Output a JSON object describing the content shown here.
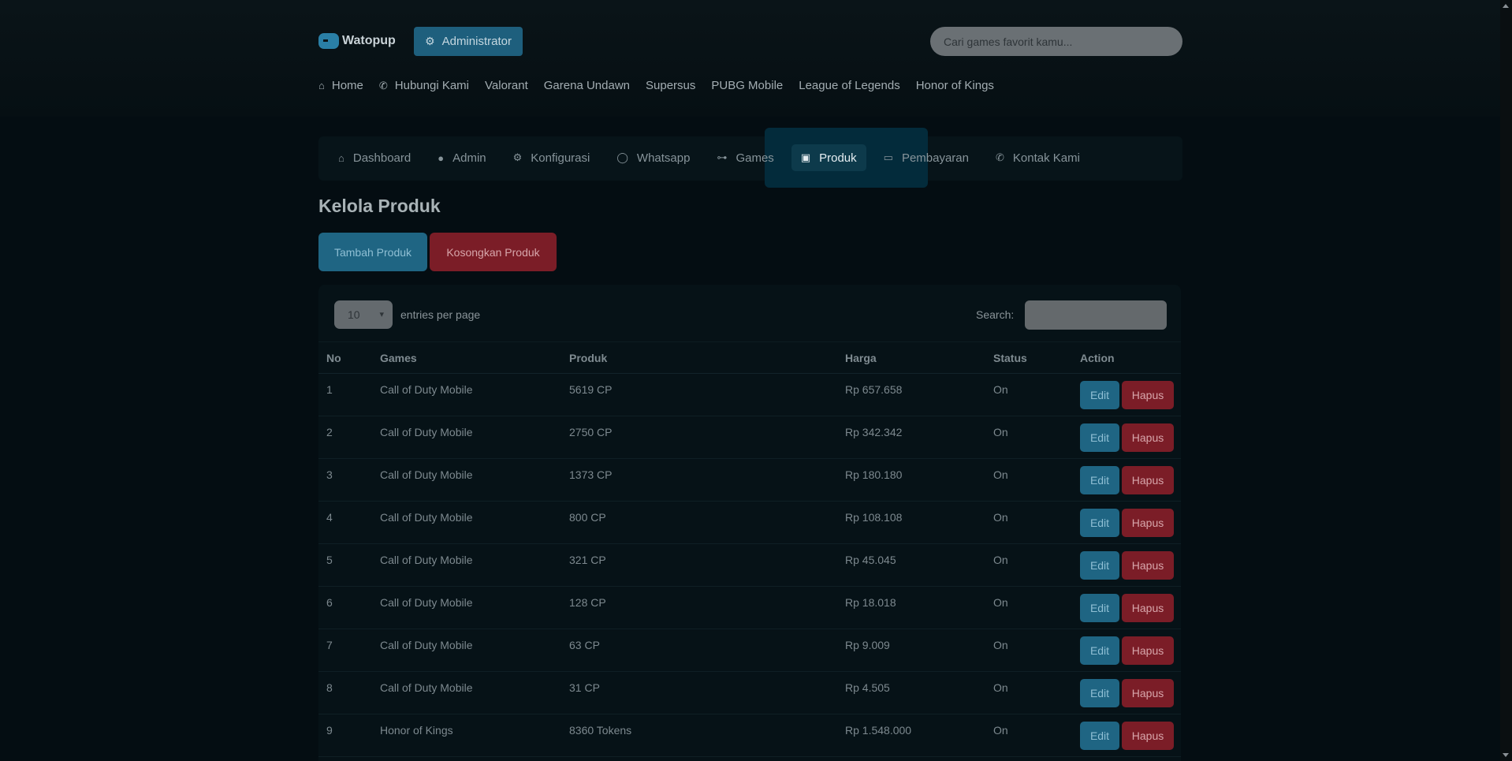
{
  "brand": {
    "name": "Watopup"
  },
  "header": {
    "admin_label": "Administrator",
    "search_placeholder": "Cari games favorit kamu..."
  },
  "topnav": [
    {
      "label": "Home",
      "icon": "home-icon"
    },
    {
      "label": "Hubungi Kami",
      "icon": "phone-icon"
    },
    {
      "label": "Valorant"
    },
    {
      "label": "Garena Undawn"
    },
    {
      "label": "Supersus"
    },
    {
      "label": "PUBG Mobile"
    },
    {
      "label": "League of Legends"
    },
    {
      "label": "Honor of Kings"
    }
  ],
  "subnav": [
    {
      "label": "Dashboard",
      "icon": "home-icon"
    },
    {
      "label": "Admin",
      "icon": "user-icon"
    },
    {
      "label": "Konfigurasi",
      "icon": "gear-icon"
    },
    {
      "label": "Whatsapp",
      "icon": "whatsapp-icon"
    },
    {
      "label": "Games",
      "icon": "gamepad-icon"
    },
    {
      "label": "Produk",
      "icon": "box-icon",
      "active": true
    },
    {
      "label": "Pembayaran",
      "icon": "card-icon"
    },
    {
      "label": "Kontak Kami",
      "icon": "phone-icon"
    }
  ],
  "page": {
    "title": "Kelola Produk",
    "add_button": "Tambah Produk",
    "clear_button": "Kosongkan Produk"
  },
  "table": {
    "entries_value": "10",
    "entries_label": "entries per page",
    "search_label": "Search:",
    "columns": [
      "No",
      "Games",
      "Produk",
      "Harga",
      "Status",
      "Action"
    ],
    "edit_label": "Edit",
    "delete_label": "Hapus",
    "rows": [
      [
        "1",
        "Call of Duty Mobile",
        "5619 CP",
        "Rp 657.658",
        "On"
      ],
      [
        "2",
        "Call of Duty Mobile",
        "2750 CP",
        "Rp 342.342",
        "On"
      ],
      [
        "3",
        "Call of Duty Mobile",
        "1373 CP",
        "Rp 180.180",
        "On"
      ],
      [
        "4",
        "Call of Duty Mobile",
        "800 CP",
        "Rp 108.108",
        "On"
      ],
      [
        "5",
        "Call of Duty Mobile",
        "321 CP",
        "Rp 45.045",
        "On"
      ],
      [
        "6",
        "Call of Duty Mobile",
        "128 CP",
        "Rp 18.018",
        "On"
      ],
      [
        "7",
        "Call of Duty Mobile",
        "63 CP",
        "Rp 9.009",
        "On"
      ],
      [
        "8",
        "Call of Duty Mobile",
        "31 CP",
        "Rp 4.505",
        "On"
      ],
      [
        "9",
        "Honor of Kings",
        "8360 Tokens",
        "Rp 1.548.000",
        "On"
      ]
    ]
  },
  "colors": {
    "background": "#040d12",
    "accent_blue": "#1f6583",
    "accent_red": "#7b1d27"
  }
}
